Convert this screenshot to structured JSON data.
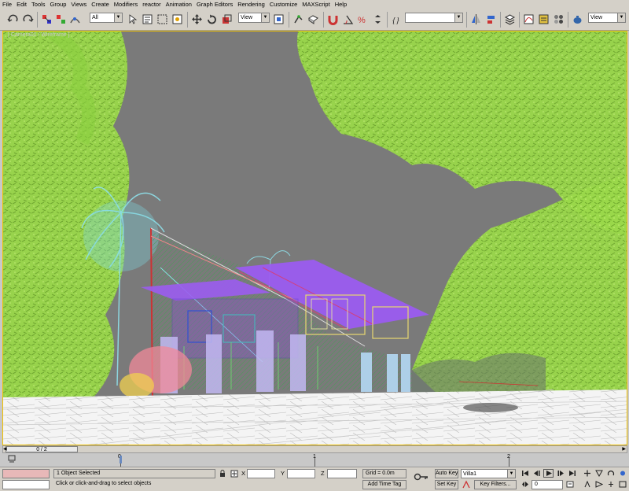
{
  "menu": [
    "File",
    "Edit",
    "Tools",
    "Group",
    "Views",
    "Create",
    "Modifiers",
    "reactor",
    "Animation",
    "Graph Editors",
    "Rendering",
    "Customize",
    "MAXScript",
    "Help"
  ],
  "toolbar": {
    "selection_filter": "All",
    "reference_coord": "View",
    "named_selection": "",
    "render_view": "View"
  },
  "viewport": {
    "label": "[ Camera01 / Wireframe ]",
    "colors": {
      "background": "#7a7a7a",
      "foliage": "#8fd23a",
      "palm": "#7fd6e0",
      "roof": "#9b5cf0",
      "ground": "#ffffff",
      "flowers": "#f08a9a",
      "column": "#b9b3f0"
    }
  },
  "timeslider": {
    "frame": "0 / 2"
  },
  "trackbar": {
    "ticks": [
      "0",
      "1",
      "2"
    ]
  },
  "status": {
    "selection": "1 Object Selected",
    "prompt": "Click or click-and-drag to select objects",
    "x_label": "X",
    "y_label": "Y",
    "z_label": "Z",
    "x_value": "",
    "y_value": "",
    "z_value": "",
    "grid": "Grid = 0.0m",
    "add_time_tag": "Add Time Tag",
    "auto_key": "Auto Key",
    "set_key": "Set Key",
    "key_set": "Villa1",
    "key_filters": "Key Filters...",
    "frame_value": "0"
  }
}
